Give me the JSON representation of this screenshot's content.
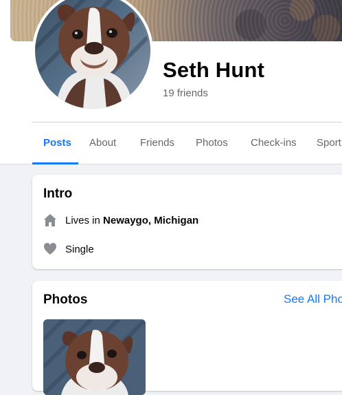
{
  "profile": {
    "name": "Seth Hunt",
    "friends_count": "19 friends"
  },
  "tabs": [
    {
      "label": "Posts",
      "active": true
    },
    {
      "label": "About"
    },
    {
      "label": "Friends"
    },
    {
      "label": "Photos"
    },
    {
      "label": "Check-ins"
    },
    {
      "label": "Sport"
    }
  ],
  "intro": {
    "title": "Intro",
    "lives_prefix": "Lives in ",
    "lives_place": "Newaygo, Michigan",
    "relationship": "Single"
  },
  "photos": {
    "title": "Photos",
    "see_all": "See All Pho"
  },
  "icons": {
    "home": "home-icon",
    "heart": "heart-icon"
  },
  "colors": {
    "accent": "#1877f2",
    "secondary_text": "#65676b",
    "background": "#f0f2f5"
  }
}
